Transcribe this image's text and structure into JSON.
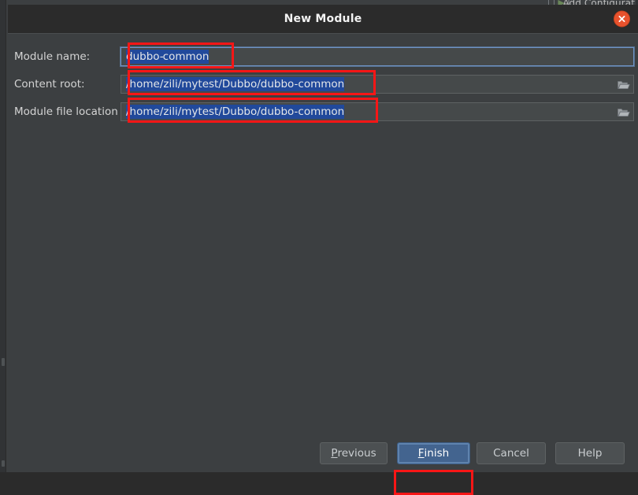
{
  "background": {
    "add_configuration_label": "Add Configurat",
    "icons": {
      "window_icon": "window-icon",
      "run_icon": "green-play-icon"
    }
  },
  "dialog": {
    "title": "New Module",
    "close_icon": "close-icon",
    "fields": [
      {
        "label": "Module name:",
        "value": "dubbo-common",
        "value_before_caret": "dubbo-",
        "value_after_caret": "common",
        "focused": true,
        "selected": true,
        "has_browse": false
      },
      {
        "label": "Content root:",
        "value": "/home/zili/mytest/Dubbo/dubbo-common",
        "focused": false,
        "selected": true,
        "has_browse": true,
        "browse_icon": "folder-icon"
      },
      {
        "label": "Module file location",
        "value": "/home/zili/mytest/Dubbo/dubbo-common",
        "focused": false,
        "selected": true,
        "has_browse": true,
        "browse_icon": "folder-icon"
      }
    ],
    "buttons": {
      "previous": {
        "label": "Previous",
        "mnemonic": "P",
        "rest": "revious"
      },
      "finish": {
        "label": "Finish",
        "mnemonic": "F",
        "rest": "inish",
        "default": true
      },
      "cancel": {
        "label": "Cancel",
        "mnemonic": "",
        "rest": "Cancel"
      },
      "help": {
        "label": "Help",
        "mnemonic": "",
        "rest": "Help"
      }
    }
  },
  "annotations": {
    "count": 4,
    "color": "#f81616",
    "targets": [
      "module-name-input",
      "content-root-input",
      "module-file-location-input",
      "finish-button"
    ]
  },
  "colors": {
    "dialog_background": "#3c3f41",
    "titlebar_background": "#2b2b2b",
    "input_background": "#45494a",
    "accent_button": "#43648f",
    "close_button": "#e8522d",
    "selection": "#21499b",
    "annotation_red": "#f81616"
  }
}
